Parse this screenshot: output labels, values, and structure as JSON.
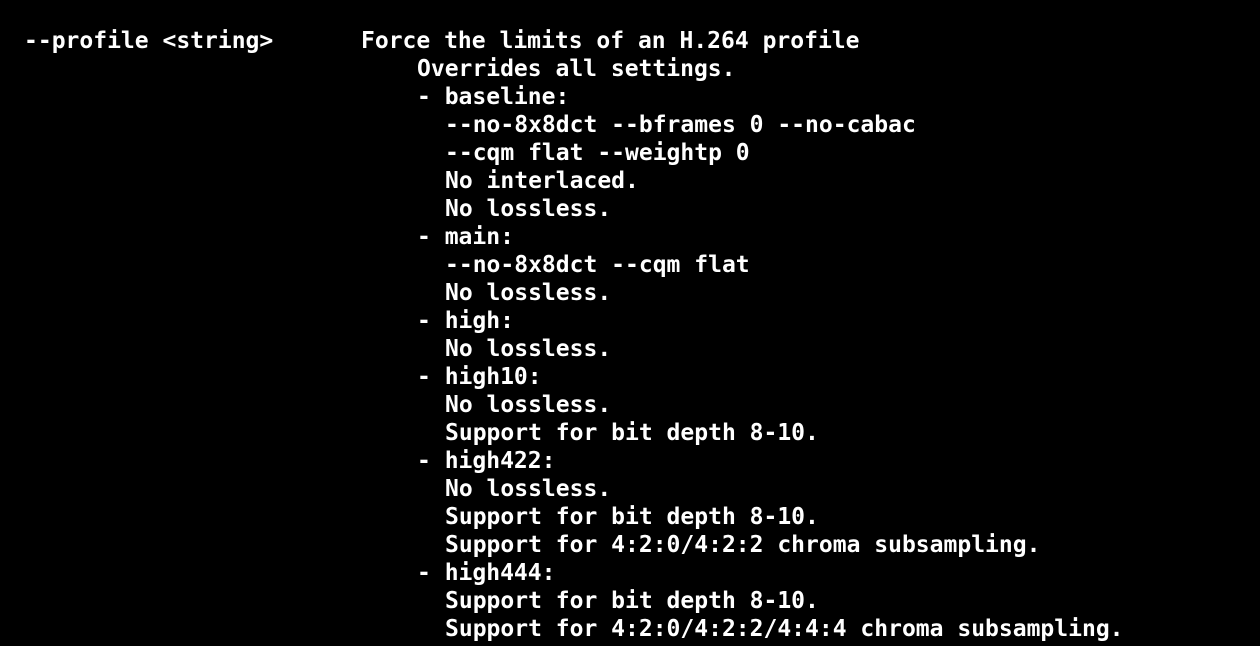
{
  "terminal": {
    "background": "#000000",
    "foreground": "#ffffff",
    "option": "--profile <string>",
    "lines": [
      "Force the limits of an H.264 profile",
      "Overrides all settings.",
      "- baseline:",
      "--no-8x8dct --bframes 0 --no-cabac",
      "--cqm flat --weightp 0",
      "No interlaced.",
      "No lossless.",
      "- main:",
      "--no-8x8dct --cqm flat",
      "No lossless.",
      "- high:",
      "No lossless.",
      "- high10:",
      "No lossless.",
      "Support for bit depth 8-10.",
      "- high422:",
      "No lossless.",
      "Support for bit depth 8-10.",
      "Support for 4:2:0/4:2:2 chroma subsampling.",
      "- high444:",
      "Support for bit depth 8-10.",
      "Support for 4:2:0/4:2:2/4:4:4 chroma subsampling."
    ]
  }
}
